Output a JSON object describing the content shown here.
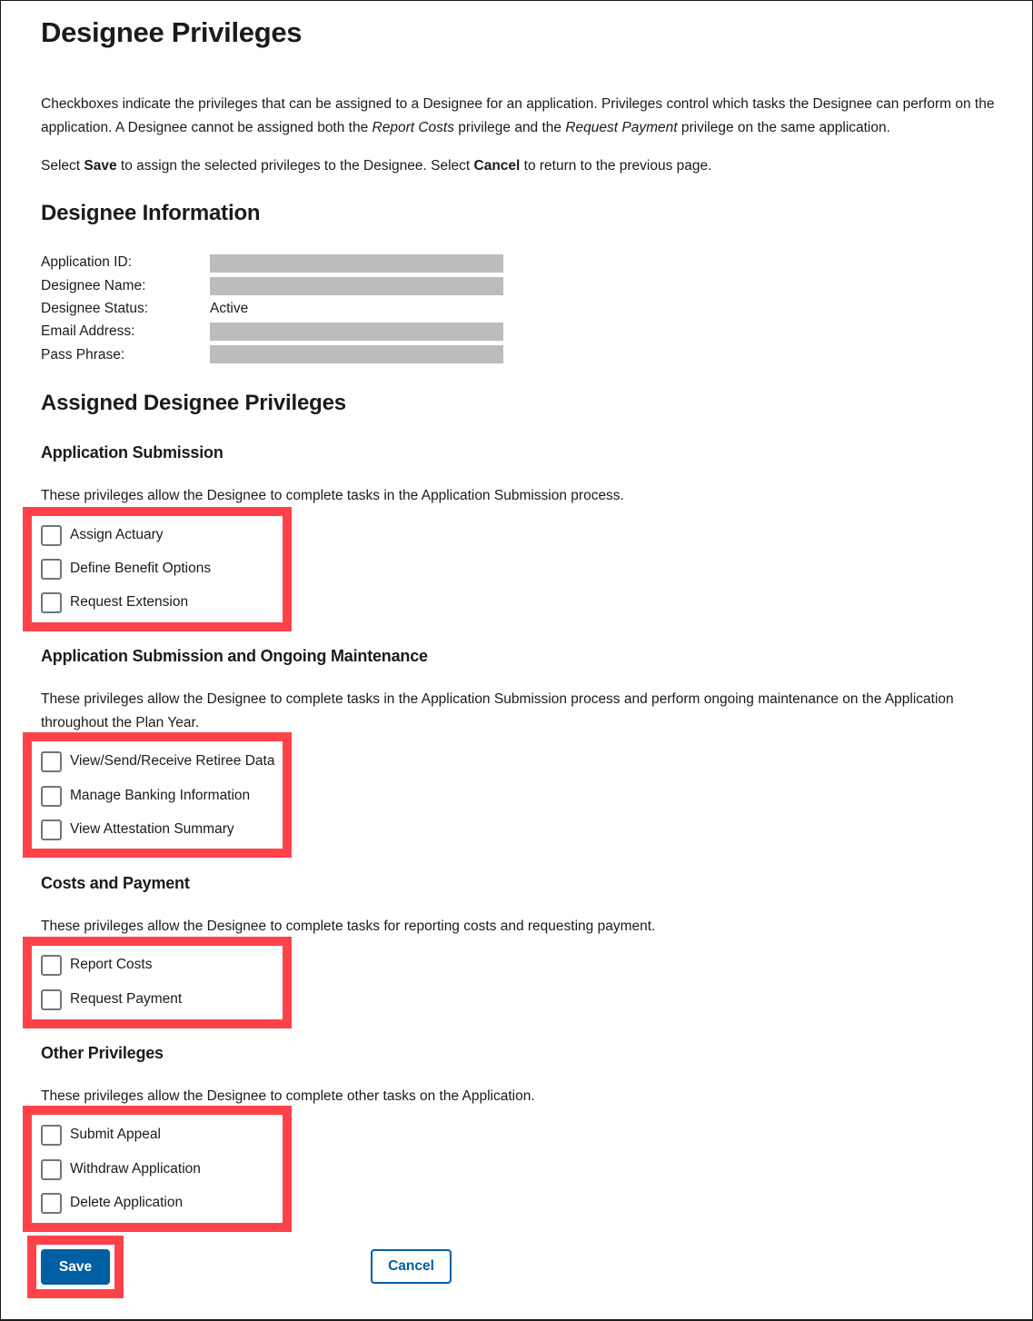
{
  "page": {
    "title": "Designee Privileges",
    "intro": {
      "line1_a": "Checkboxes indicate the privileges that can be assigned to a Designee for an application. Privileges control which tasks the Designee can perform on the",
      "line2_a": "application. A Designee cannot be assigned both the ",
      "line2_em1": "Report Costs",
      "line2_b": " privilege and the ",
      "line2_em2": "Request Payment",
      "line2_c": " privilege on the same application."
    },
    "instructions": {
      "a": "Select ",
      "save_word": "Save",
      "b": " to assign the selected privileges to the Designee. Select ",
      "cancel_word": "Cancel",
      "c": " to return to the previous page."
    }
  },
  "designee_info": {
    "heading": "Designee Information",
    "fields": [
      {
        "label": "Application ID:",
        "value": "",
        "redacted": true
      },
      {
        "label": "Designee Name:",
        "value": "",
        "redacted": true
      },
      {
        "label": "Designee Status:",
        "value": "Active",
        "redacted": false
      },
      {
        "label": "Email Address:",
        "value": "",
        "redacted": true
      },
      {
        "label": "Pass Phrase:",
        "value": "",
        "redacted": true
      }
    ]
  },
  "privileges": {
    "heading": "Assigned Designee Privileges",
    "groups": [
      {
        "title": "Application Submission",
        "description": "These privileges allow the Designee to complete tasks in the Application Submission process.",
        "items": [
          {
            "label": "Assign Actuary",
            "checked": false
          },
          {
            "label": "Define Benefit Options",
            "checked": false
          },
          {
            "label": "Request Extension",
            "checked": false
          }
        ]
      },
      {
        "title": "Application Submission and Ongoing Maintenance",
        "description_line1": "These privileges allow the Designee to complete tasks in the Application Submission process and perform ongoing maintenance on the Application",
        "description_line2": "throughout the Plan Year.",
        "items": [
          {
            "label": "View/Send/Receive Retiree Data",
            "checked": false
          },
          {
            "label": "Manage Banking Information",
            "checked": false
          },
          {
            "label": "View Attestation Summary",
            "checked": false
          }
        ]
      },
      {
        "title": "Costs and Payment",
        "description": "These privileges allow the Designee to complete tasks for reporting costs and requesting payment.",
        "items": [
          {
            "label": "Report Costs",
            "checked": false
          },
          {
            "label": "Request Payment",
            "checked": false
          }
        ]
      },
      {
        "title": "Other Privileges",
        "description": "These privileges allow the Designee to complete other tasks on the Application.",
        "items": [
          {
            "label": "Submit Appeal",
            "checked": false
          },
          {
            "label": "Withdraw Application",
            "checked": false
          },
          {
            "label": "Delete Application",
            "checked": false
          }
        ]
      }
    ]
  },
  "actions": {
    "save_label": "Save",
    "cancel_label": "Cancel"
  },
  "colors": {
    "primary": "#005ea2",
    "highlight": "#fd4349",
    "redacted": "#bcbcbc",
    "checkbox_border": "#71767a"
  }
}
